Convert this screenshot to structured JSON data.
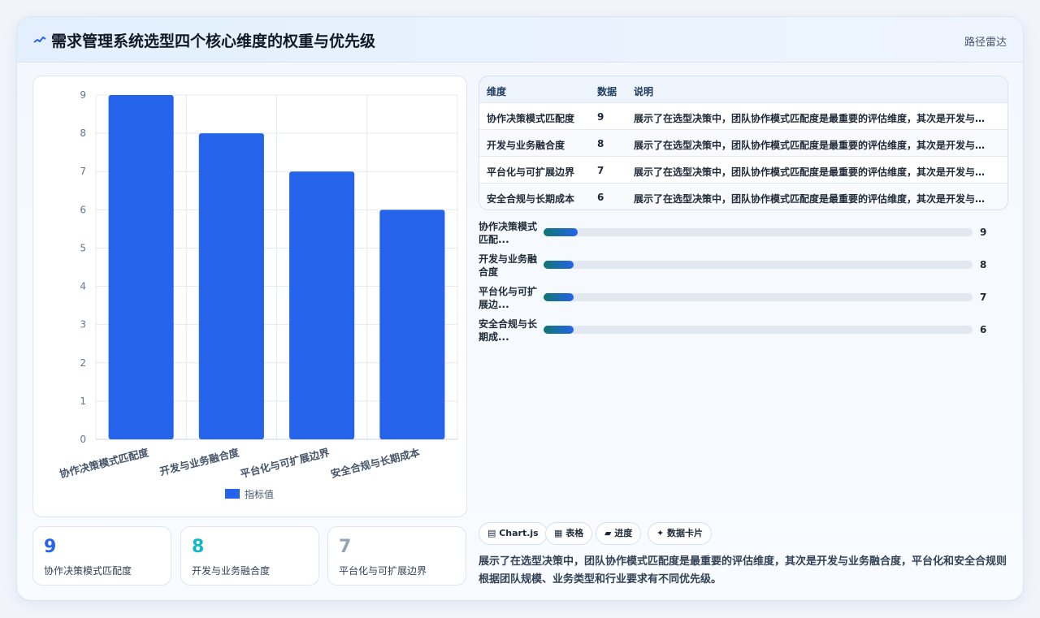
{
  "header": {
    "title": "需求管理系统选型四个核心维度的权重与优先级",
    "link": "路径雷达"
  },
  "colors": {
    "bar": "#2563eb",
    "stat1": "#2563eb",
    "stat2": "#14b8c4",
    "stat3": "#94a3b8"
  },
  "chart_data": {
    "type": "bar",
    "categories": [
      "协作决策模式匹配度",
      "开发与业务融合度",
      "平台化与可扩展边界",
      "安全合规与长期成本"
    ],
    "series": [
      {
        "name": "指标值",
        "values": [
          9,
          8,
          7,
          6
        ]
      }
    ],
    "ylim": [
      0,
      9
    ],
    "yticks": [
      "0",
      "1",
      "2",
      "3",
      "4",
      "5",
      "6",
      "7",
      "8",
      "9"
    ],
    "grid": true,
    "legend": "bottom"
  },
  "stats": [
    {
      "value": "9",
      "label": "协作决策模式匹配度"
    },
    {
      "value": "8",
      "label": "开发与业务融合度"
    },
    {
      "value": "7",
      "label": "平台化与可扩展边界"
    }
  ],
  "table": {
    "headers": [
      "维度",
      "数据",
      "说明"
    ],
    "rows": [
      {
        "dim": "协作决策模式匹配度",
        "val": "9",
        "desc": "展示了在选型决策中，团队协作模式匹配度是最重要的评估维度，其次是开发与业务融合度，平台化和安全合规则根据团队规模、业务类型和行业要求有不同优先级。"
      },
      {
        "dim": "开发与业务融合度",
        "val": "8",
        "desc": "展示了在选型决策中，团队协作模式匹配度是最重要的评估维度，其次是开发与业务融合度，平台化和安全合规则根据团队规模、业务类型和行业要求有不同优先级。"
      },
      {
        "dim": "平台化与可扩展边界",
        "val": "7",
        "desc": "展示了在选型决策中，团队协作模式匹配度是最重要的评估维度，其次是开发与业务融合度，平台化和安全合规则根据团队规模、业务类型和行业要求有不同优先级。"
      },
      {
        "dim": "安全合规与长期成本",
        "val": "6",
        "desc": "展示了在选型决策中，团队协作模式匹配度是最重要的评估维度，其次是开发与业务融合度，平台化和安全合规则根据团队规模、业务类型和行业要求有不同优先级。"
      }
    ]
  },
  "progress": [
    {
      "label": "协作决策模式匹配...",
      "value": "9",
      "fraction": 0.08
    },
    {
      "label": "开发与业务融合度",
      "value": "8",
      "fraction": 0.07
    },
    {
      "label": "平台化与可扩展边...",
      "value": "7",
      "fraction": 0.07
    },
    {
      "label": "安全合规与长期成...",
      "value": "6",
      "fraction": 0.07
    }
  ],
  "chips": [
    "▤ Chart.js",
    "▦ 表格",
    "▰ 进度",
    "✦ 数据卡片"
  ],
  "summary": "展示了在选型决策中，团队协作模式匹配度是最重要的评估维度，其次是开发与业务融合度，平台化和安全合规则根据团队规模、业务类型和行业要求有不同优先级。"
}
